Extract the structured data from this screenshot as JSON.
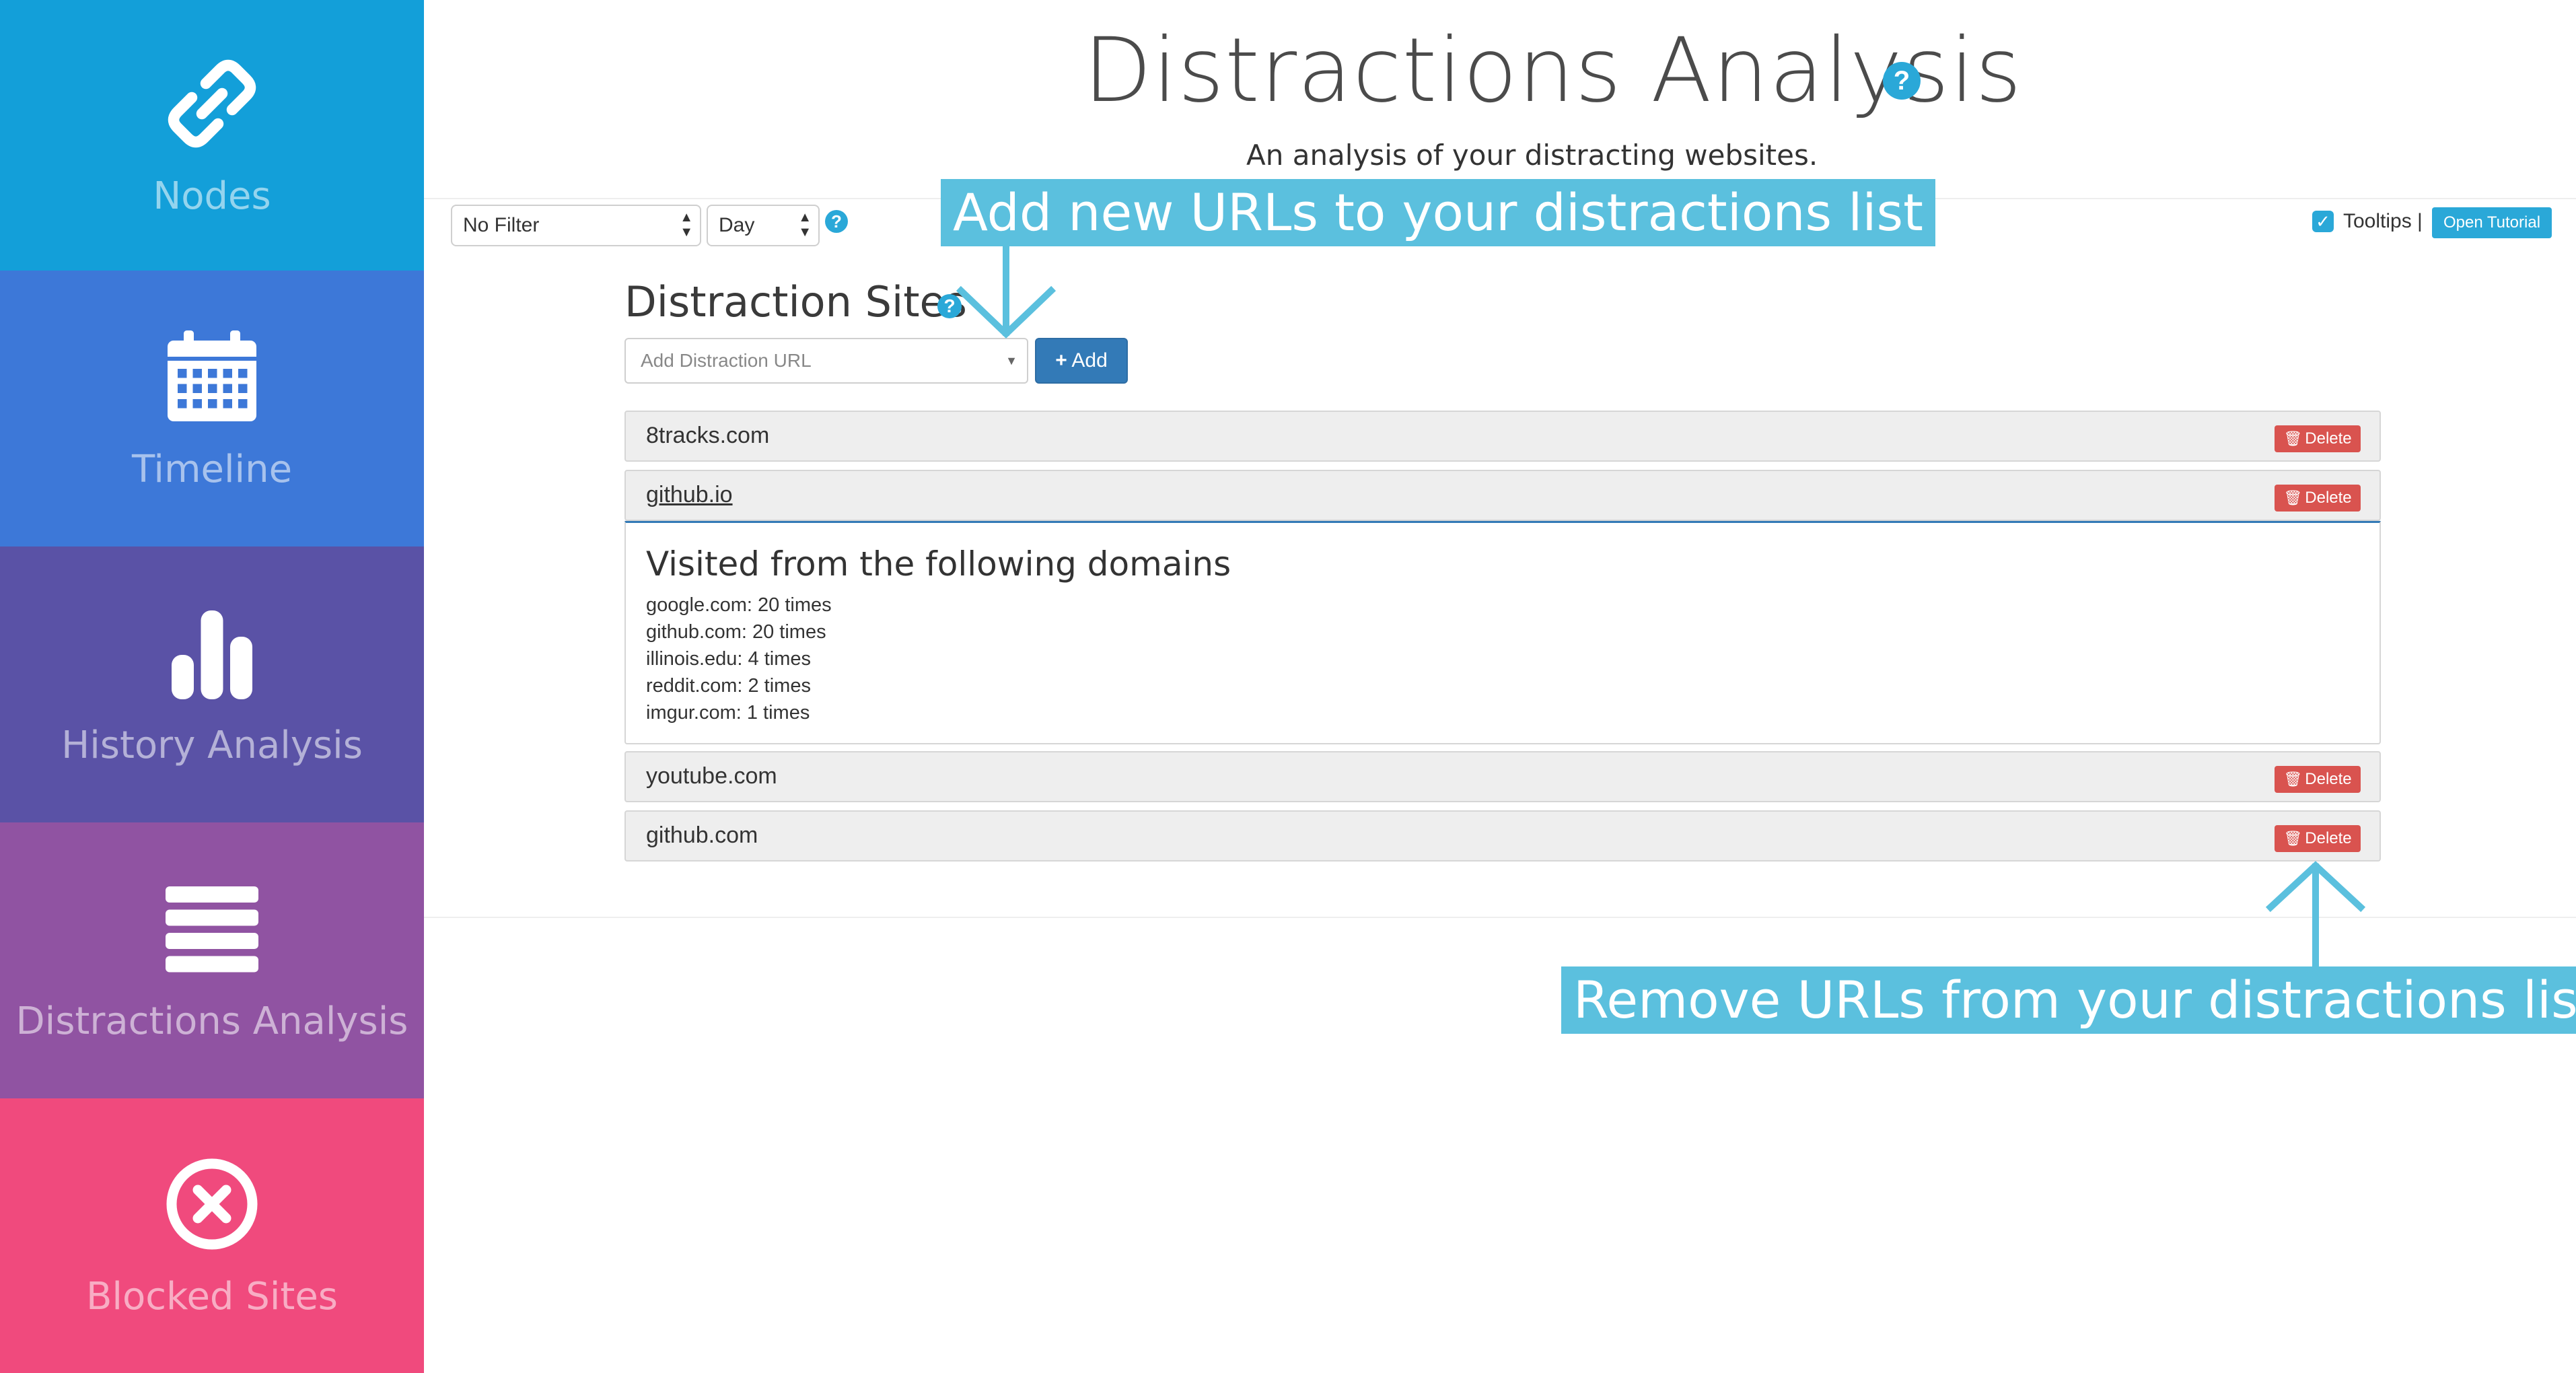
{
  "sidebar": {
    "items": [
      {
        "label": "Nodes",
        "icon": "link-icon"
      },
      {
        "label": "Timeline",
        "icon": "calendar-icon"
      },
      {
        "label": "History Analysis",
        "icon": "bar-chart-icon"
      },
      {
        "label": "Distractions Analysis",
        "icon": "list-icon"
      },
      {
        "label": "Blocked Sites",
        "icon": "block-icon"
      }
    ]
  },
  "header": {
    "title": "Distractions Analysis",
    "subtitle": "An analysis of your distracting websites."
  },
  "filters": {
    "filter_value": "No Filter",
    "period_value": "Day"
  },
  "tooltips": {
    "label": "Tooltips |",
    "open_tutorial": "Open Tutorial"
  },
  "distraction_sites": {
    "title": "Distraction Sites",
    "input_placeholder": "Add Distraction URL",
    "add_label": "Add",
    "delete_label": "Delete",
    "sites": [
      "8tracks.com",
      "github.io",
      "youtube.com",
      "github.com"
    ],
    "detail": {
      "heading": "Visited from the following domains",
      "domains": [
        "google.com: 20 times",
        "github.com: 20 times",
        "illinois.edu: 4 times",
        "reddit.com: 2 times",
        "imgur.com: 1 times"
      ]
    }
  },
  "callouts": {
    "add": "Add new URLs to your distractions list",
    "remove": "Remove URLs from your distractions list"
  },
  "colors": {
    "nodes": "#139fd9",
    "timeline": "#3d78d8",
    "history": "#5a52a6",
    "distractions": "#9053a2",
    "blocked": "#f04a7d",
    "accent": "#2aa8d8",
    "callout": "#5bc0de",
    "primary_button": "#337ab7",
    "danger_button": "#d9534f"
  }
}
